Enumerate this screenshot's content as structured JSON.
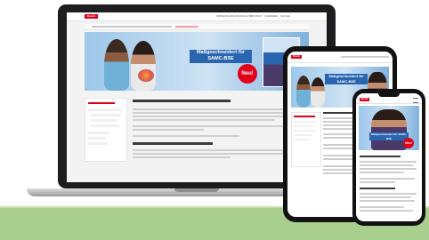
{
  "site": {
    "logo_text": "Bosch",
    "nav": [
      "IMPRESSUM",
      "DATENSCHUTZ",
      "KONTAKT",
      "KARRIERE",
      "SUCHE"
    ],
    "hero_banner": "Maßgeschneidert für SAMC-BSE",
    "hero_badge": "Neu!",
    "accent_color": "#e2001a",
    "banner_color": "#2a65b0"
  }
}
